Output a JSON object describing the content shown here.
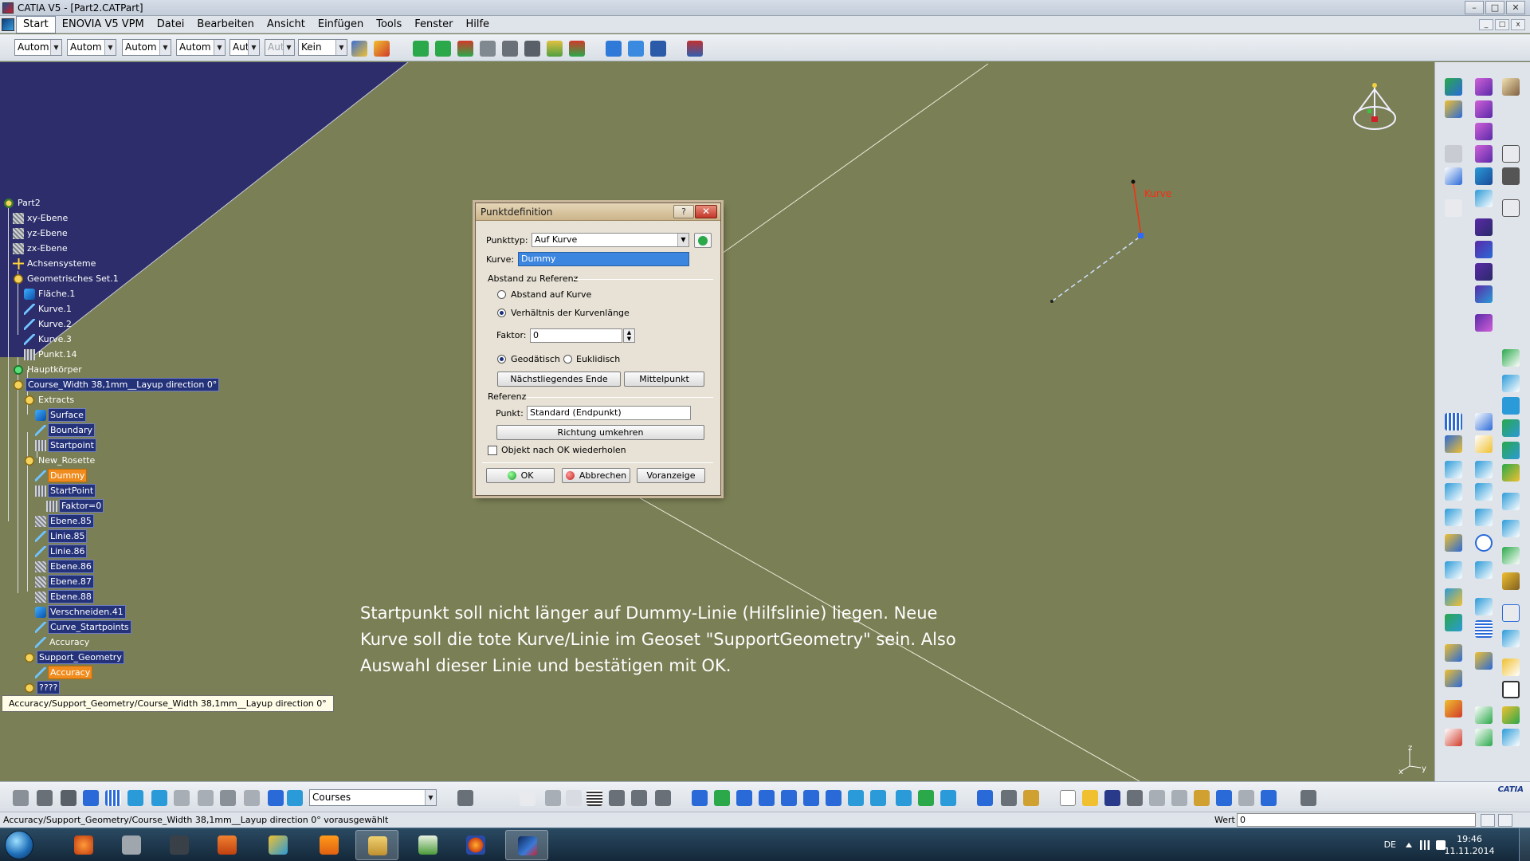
{
  "window": {
    "title": "CATIA V5 - [Part2.CATPart]",
    "controls": [
      "–",
      "□",
      "✕"
    ],
    "doc_controls": [
      "_",
      "□",
      "x"
    ]
  },
  "menu": [
    "Start",
    "ENOVIA V5 VPM",
    "Datei",
    "Bearbeiten",
    "Ansicht",
    "Einfügen",
    "Tools",
    "Fenster",
    "Hilfe"
  ],
  "toolbar": {
    "combos": [
      "Autom",
      "Autom",
      "Autom",
      "Autom",
      "Aut",
      "Aut",
      "Kein"
    ]
  },
  "tree": {
    "nodes": [
      {
        "label": "Part2",
        "icon": "root-icon"
      },
      {
        "label": "xy-Ebene",
        "icon": "plane-icon"
      },
      {
        "label": "yz-Ebene",
        "icon": "plane-icon"
      },
      {
        "label": "zx-Ebene",
        "icon": "plane-icon"
      },
      {
        "label": "Achsensysteme",
        "icon": "axis-system-icon"
      },
      {
        "label": "Geometrisches Set.1",
        "icon": "geoset-icon"
      },
      {
        "label": "Fläche.1",
        "icon": "surface-icon"
      },
      {
        "label": "Kurve.1",
        "icon": "curve-icon"
      },
      {
        "label": "Kurve.2",
        "icon": "curve-icon"
      },
      {
        "label": "Kurve.3",
        "icon": "curve-icon"
      },
      {
        "label": "Punkt.14",
        "icon": "point-icon"
      },
      {
        "label": "Hauptkörper",
        "icon": "body-icon"
      },
      {
        "label": "Course_Width 38,1mm__Layup direction 0°",
        "icon": "geoset-icon"
      },
      {
        "label": "Extracts",
        "icon": "geoset-icon"
      },
      {
        "label": "Surface",
        "icon": "surface-icon"
      },
      {
        "label": "Boundary",
        "icon": "curve-icon"
      },
      {
        "label": "Startpoint",
        "icon": "point-icon"
      },
      {
        "label": "New_Rosette",
        "icon": "geoset-icon"
      },
      {
        "label": "Dummy",
        "icon": "line-icon"
      },
      {
        "label": "StartPoint",
        "icon": "point-icon"
      },
      {
        "label": "Faktor=0",
        "icon": "parameter-icon"
      },
      {
        "label": "Ebene.85",
        "icon": "plane-icon"
      },
      {
        "label": "Linie.85",
        "icon": "line-icon"
      },
      {
        "label": "Linie.86",
        "icon": "line-icon"
      },
      {
        "label": "Ebene.86",
        "icon": "plane-icon"
      },
      {
        "label": "Ebene.87",
        "icon": "plane-icon"
      },
      {
        "label": "Ebene.88",
        "icon": "plane-icon"
      },
      {
        "label": "Verschneiden.41",
        "icon": "intersect-icon"
      },
      {
        "label": "Curve_Startpoints",
        "icon": "curve-icon"
      },
      {
        "label": "Accuracy",
        "icon": "curve-icon"
      },
      {
        "label": "Support_Geometry",
        "icon": "geoset-icon"
      },
      {
        "label": "Accuracy",
        "icon": "line-icon"
      },
      {
        "label": "????",
        "icon": "geoset-icon"
      }
    ],
    "tooltip": "Accuracy/Support_Geometry/Course_Width 38,1mm__Layup direction 0°"
  },
  "viewport": {
    "curve_label": "Kurve",
    "annotation": "Startpunkt soll nicht länger auf Dummy-Linie (Hilfslinie) liegen. Neue Kurve soll die tote Kurve/Linie im Geoset \"SupportGeometry\" sein. Also Auswahl dieser Linie und bestätigen mit OK.",
    "axis_labels": {
      "z": "z",
      "x": "x",
      "y": "y"
    }
  },
  "dialog": {
    "title": "Punktdefinition",
    "help": "?",
    "close": "✕",
    "punkttyp_label": "Punkttyp:",
    "punkttyp_value": "Auf Kurve",
    "kurve_label": "Kurve:",
    "kurve_value": "Dummy",
    "abstand_group": "Abstand zu Referenz",
    "radio_abstand": "Abstand auf Kurve",
    "radio_verhaeltnis": "Verhältnis der Kurvenlänge",
    "faktor_label": "Faktor:",
    "faktor_value": "0",
    "radio_geodaetisch": "Geodätisch",
    "radio_euklidisch": "Euklidisch",
    "btn_naechstes": "Nächstliegendes Ende",
    "btn_mittelpunkt": "Mittelpunkt",
    "referenz_group": "Referenz",
    "punkt_label": "Punkt:",
    "punkt_value": "Standard (Endpunkt)",
    "btn_richtung": "Richtung umkehren",
    "chk_wiederholen": "Objekt nach OK wiederholen",
    "btn_ok": "OK",
    "btn_abbrechen": "Abbrechen",
    "btn_voranzeige": "Voranzeige"
  },
  "bottombar": {
    "combo_value": "Courses",
    "logo": "CATIA"
  },
  "status": {
    "message": "Accuracy/Support_Geometry/Course_Width 38,1mm__Layup direction 0° vorausgewählt",
    "wert_label": "Wert",
    "wert_value": "0"
  },
  "taskbar": {
    "lang": "DE",
    "time": "19:46",
    "date": "11.11.2014"
  },
  "colors": {
    "viewport": "#7a7f55",
    "tree_bg": "#2c2d6a",
    "selection": "#f08c1e",
    "curve_red": "#ff2a10"
  }
}
